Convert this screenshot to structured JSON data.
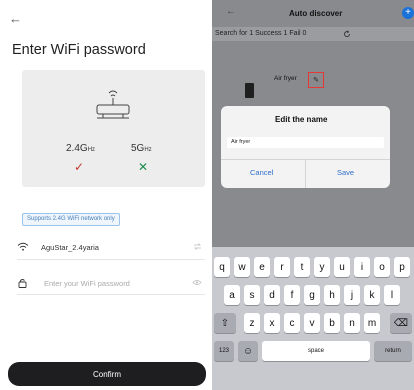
{
  "left": {
    "back_icon": "←",
    "title": "Enter WiFi password",
    "band_24": "2.4G",
    "band_24_unit": "Hz",
    "band_5": "5G",
    "band_5_unit": "Hz",
    "check_icon": "✓",
    "cross_icon": "✕",
    "support_tag": "Supports 2.4G WiFi network only",
    "wifi_name": "AguStar_2.4yaria",
    "password_placeholder": "Enter your WiFi password",
    "confirm_label": "Confirm"
  },
  "right": {
    "back_icon": "←",
    "nav_title": "Auto discover",
    "plus_icon": "+",
    "status": "Search for 1  Success 1  Fail 0",
    "device_name": "Air fryer",
    "edit_icon": "✎",
    "dialog": {
      "title": "Edit the name",
      "input_value": "Air fryer",
      "cancel": "Cancel",
      "save": "Save"
    },
    "keyboard": {
      "row1": [
        "q",
        "w",
        "e",
        "r",
        "t",
        "y",
        "u",
        "i",
        "o",
        "p"
      ],
      "row2": [
        "a",
        "s",
        "d",
        "f",
        "g",
        "h",
        "j",
        "k",
        "l"
      ],
      "row3": [
        "z",
        "x",
        "c",
        "v",
        "b",
        "n",
        "m"
      ],
      "shift_icon": "⇧",
      "delete_icon": "⌫",
      "numbers": "123",
      "emoji_icon": "☺",
      "space": "space",
      "return": "return"
    }
  },
  "colors": {
    "confirm_bg": "#1e1e20",
    "check": "#c0392b",
    "cross": "#1e8c4f",
    "highlight": "#e53935",
    "link": "#2f6ec8"
  }
}
